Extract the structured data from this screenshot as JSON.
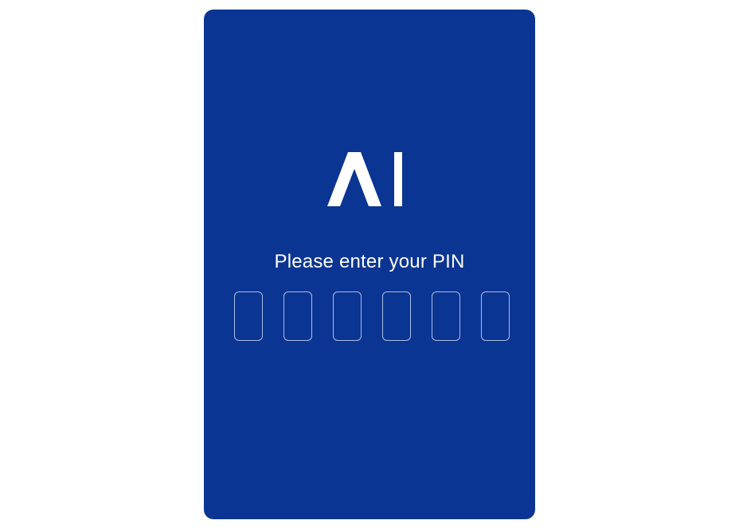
{
  "logo": {
    "text": "AI",
    "icon": "ai-logo",
    "color": "#ffffff"
  },
  "prompt": {
    "text": "Please enter your PIN"
  },
  "pin": {
    "length": 6,
    "digits": [
      "",
      "",
      "",
      "",
      "",
      ""
    ]
  },
  "colors": {
    "card_background": "#0b3593",
    "page_background": "#ffffff",
    "text": "#ffffff",
    "pin_border": "#c8d6f0"
  }
}
